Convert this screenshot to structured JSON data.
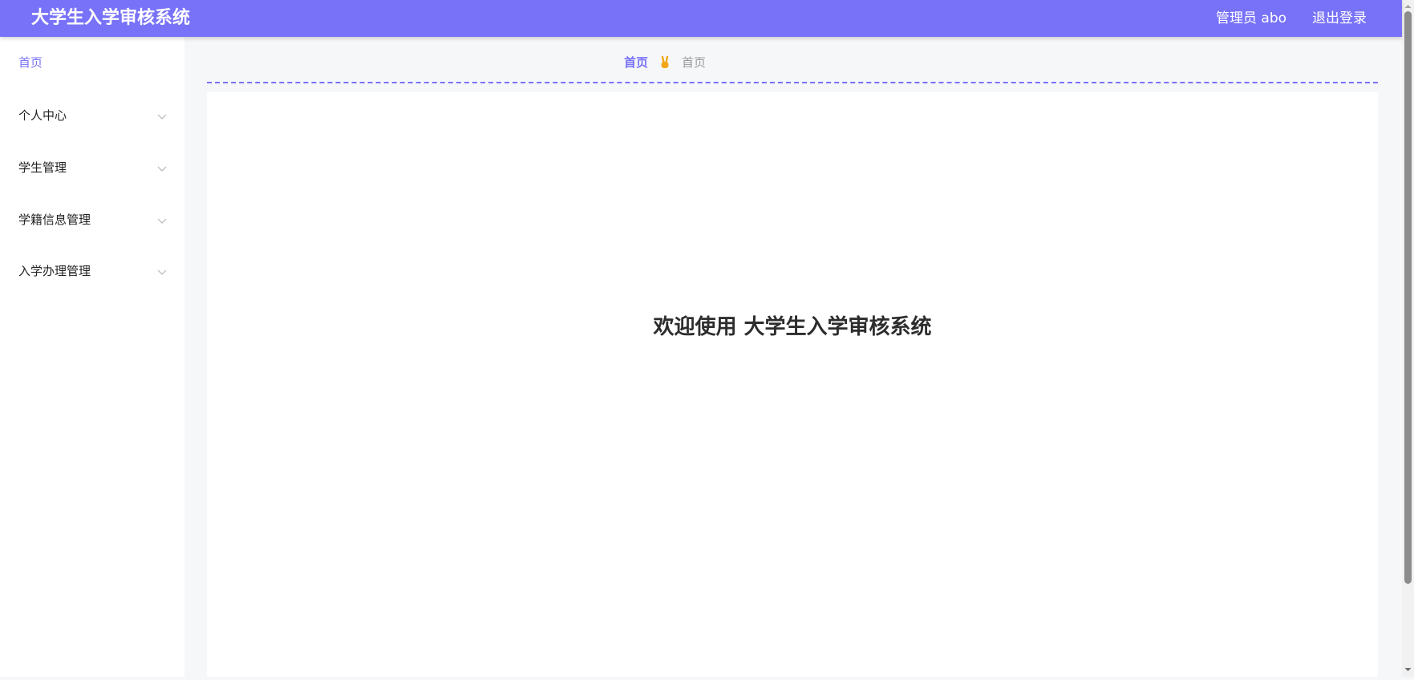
{
  "header": {
    "app_title": "大学生入学审核系统",
    "admin_label": "管理员 abo",
    "logout_label": "退出登录",
    "accent_color": "#7872f8"
  },
  "sidebar": {
    "items": [
      {
        "label": "首页",
        "active": true
      },
      {
        "label": "个人中心",
        "icon": "chevron-down-icon"
      },
      {
        "label": "学生管理",
        "icon": "chevron-down-icon"
      },
      {
        "label": "学籍信息管理",
        "icon": "chevron-down-icon"
      },
      {
        "label": "入学办理管理",
        "icon": "chevron-down-icon"
      }
    ]
  },
  "breadcrumb": {
    "home": "首页",
    "separator_icon": "victory-hand-icon",
    "current": "首页"
  },
  "main": {
    "welcome": "欢迎使用 大学生入学审核系统"
  }
}
